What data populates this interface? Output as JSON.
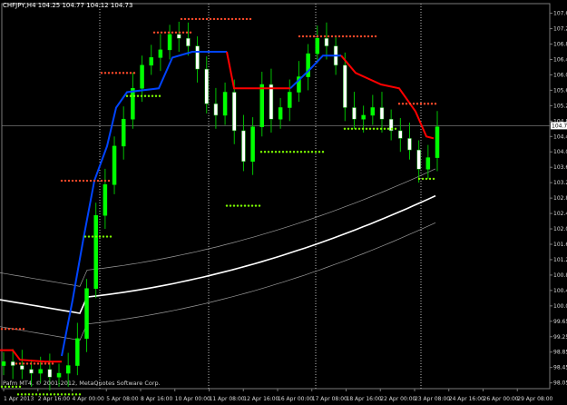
{
  "header": {
    "text": "CHFJPY,H4  104.25 104.77 104.12 104.73"
  },
  "footer": {
    "text": "Pafm MT4, © 2001-2012, MetaQuotes Software Corp."
  },
  "price_axis": {
    "labels": [
      "107.65",
      "107.25",
      "106.85",
      "106.45",
      "106.05",
      "105.65",
      "105.25",
      "104.85",
      "104.45",
      "104.05",
      "103.65",
      "103.25",
      "102.85",
      "102.45",
      "102.05",
      "101.65",
      "101.25",
      "100.85",
      "100.45",
      "100.05",
      "99.65",
      "99.25",
      "98.85",
      "98.45",
      "98.05"
    ],
    "current_price": "104.73"
  },
  "time_axis": {
    "labels": [
      "1 Apr 2013",
      "2 Apr 16:00",
      "4 Apr 00:00",
      "5 Apr 08:00",
      "8 Apr 16:00",
      "10 Apr 00:00",
      "11 Apr 08:00",
      "12 Apr 16:00",
      "16 Apr 00:00",
      "17 Apr 08:00",
      "18 Apr 16:00",
      "22 Apr 00:00",
      "23 Apr 08:00",
      "24 Apr 16:00",
      "26 Apr 00:00",
      "29 Apr 08:00"
    ]
  },
  "colors": {
    "background": "#000000",
    "bull_candle": "#00ff00",
    "bear_candle": "#ffffff",
    "wick": "#00c000",
    "supertrend_up": "#0044ff",
    "supertrend_down": "#ff0000",
    "dots_resistance": "#ff4a2a",
    "dots_support": "#7cfc00",
    "ma_center": "#ffffff",
    "ma_bands": "#9a9a9a",
    "grid": "#7a7a7a",
    "axis_text": "#d8d8d8"
  },
  "chart_data": {
    "type": "candlestick",
    "symbol": "CHFJPY",
    "timeframe": "H4",
    "ohlc_last": {
      "open": 104.25,
      "high": 104.77,
      "low": 104.12,
      "close": 104.73
    },
    "ylim": [
      97.9,
      107.9
    ],
    "close_path": [
      98.6,
      98.5,
      98.4,
      98.3,
      98.4,
      98.2,
      98.3,
      98.5,
      99.2,
      100.5,
      102.4,
      103.2,
      104.2,
      104.9,
      105.7,
      106.3,
      106.5,
      106.7,
      107.1,
      107.0,
      106.8,
      106.2,
      105.3,
      105.0,
      105.6,
      104.6,
      103.8,
      104.7,
      105.8,
      104.9,
      105.2,
      105.6,
      106.0,
      106.6,
      107.0,
      106.8,
      106.3,
      105.2,
      104.9,
      105.0,
      105.2,
      104.9,
      104.6,
      104.4,
      104.1,
      103.6,
      103.9,
      104.7
    ],
    "series": [
      {
        "name": "supertrend",
        "values": []
      },
      {
        "name": "moving_average",
        "values": []
      }
    ]
  }
}
